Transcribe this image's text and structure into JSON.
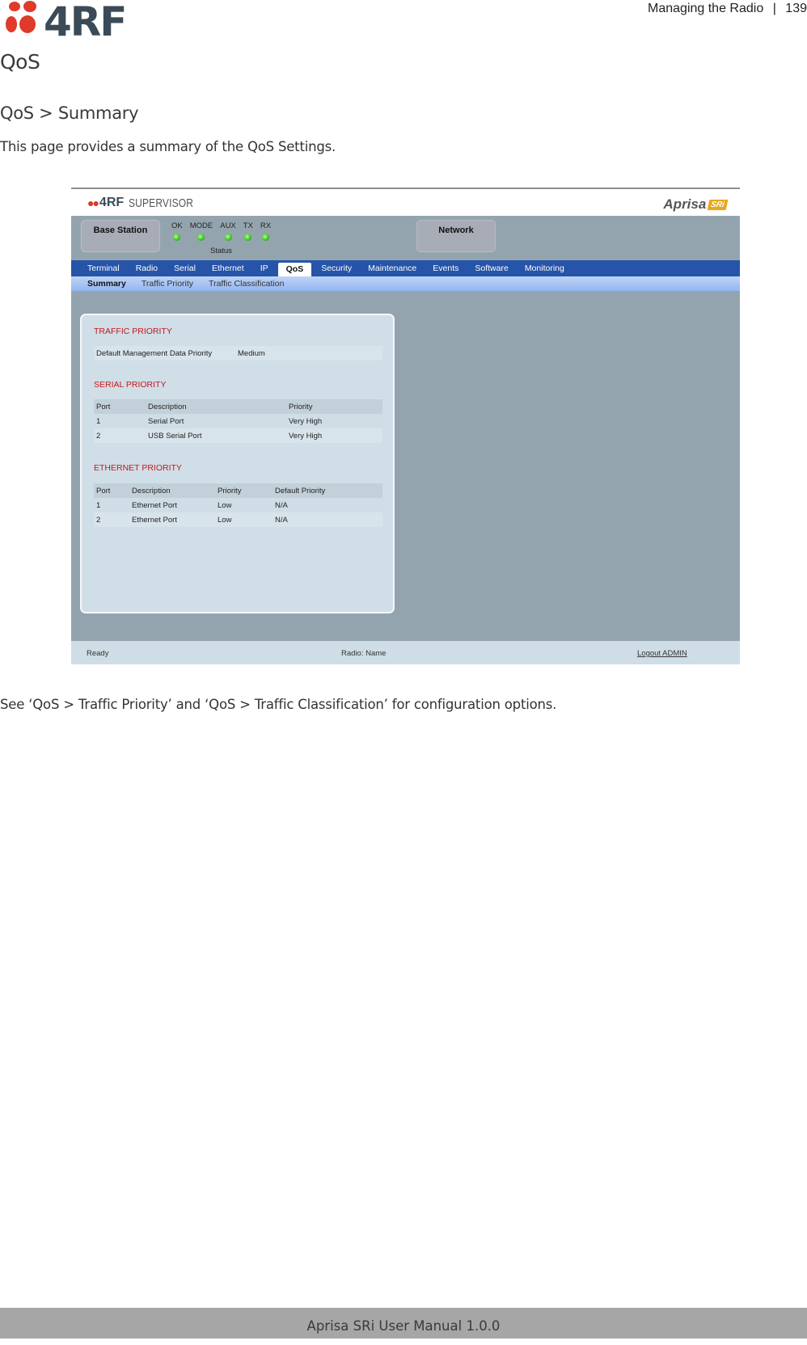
{
  "page_header": {
    "logo_text": "4RF",
    "section": "Managing the Radio",
    "separator": "|",
    "page_number": "139"
  },
  "doc": {
    "heading": "QoS",
    "subheading": "QoS > Summary",
    "intro": "This page provides a summary of the QoS Settings.",
    "outro": "See ‘QoS > Traffic Priority’ and ‘QoS > Traffic Classification’ for configuration options."
  },
  "app": {
    "brand_logo": "4RF",
    "brand_product": "SUPERVISOR",
    "device_logo": "Aprisa",
    "device_badge": "SRi",
    "station_label": "Base Station",
    "network_label": "Network",
    "status_caption": "Status",
    "leds": [
      {
        "label": "OK",
        "state": "green"
      },
      {
        "label": "MODE",
        "state": "green"
      },
      {
        "label": "AUX",
        "state": "green"
      },
      {
        "label": "TX",
        "state": "green"
      },
      {
        "label": "RX",
        "state": "green"
      }
    ],
    "nav_tabs": [
      "Terminal",
      "Radio",
      "Serial",
      "Ethernet",
      "IP",
      "QoS",
      "Security",
      "Maintenance",
      "Events",
      "Software",
      "Monitoring"
    ],
    "active_tab": "QoS",
    "sub_tabs": [
      "Summary",
      "Traffic Priority",
      "Traffic Classification"
    ],
    "active_sub_tab": "Summary",
    "traffic_priority": {
      "title": "TRAFFIC PRIORITY",
      "label": "Default Management Data Priority",
      "value": "Medium"
    },
    "serial_priority": {
      "title": "SERIAL PRIORITY",
      "headers": [
        "Port",
        "Description",
        "Priority"
      ],
      "rows": [
        [
          "1",
          "Serial Port",
          "Very High"
        ],
        [
          "2",
          "USB Serial Port",
          "Very High"
        ]
      ]
    },
    "ethernet_priority": {
      "title": "ETHERNET PRIORITY",
      "headers": [
        "Port",
        "Description",
        "Priority",
        "Default Priority"
      ],
      "rows": [
        [
          "1",
          "Ethernet Port",
          "Low",
          "N/A"
        ],
        [
          "2",
          "Ethernet Port",
          "Low",
          "N/A"
        ]
      ]
    },
    "statusbar": {
      "state": "Ready",
      "radio": "Radio: Name",
      "logout": "Logout ADMIN"
    },
    "colors": {
      "nav_bar": "#2554a8",
      "section_title": "#c8161d",
      "led_on": "#35c11f"
    }
  },
  "footer": {
    "text": "Aprisa SRi User Manual 1.0.0"
  }
}
